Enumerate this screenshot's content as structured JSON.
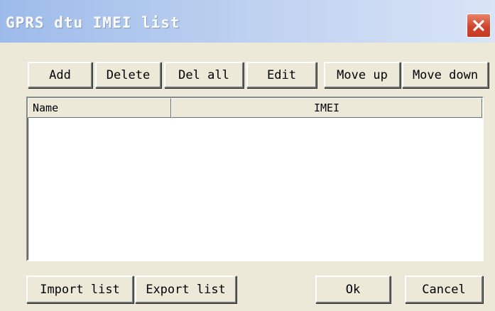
{
  "window": {
    "title": "GPRS dtu IMEI list"
  },
  "toolbar": {
    "add_label": "Add",
    "delete_label": "Delete",
    "del_all_label": "Del all",
    "edit_label": "Edit",
    "move_up_label": "Move up",
    "move_down_label": "Move down"
  },
  "list": {
    "columns": [
      "Name",
      "IMEI"
    ],
    "rows": []
  },
  "footer": {
    "import_label": "Import list",
    "export_label": "Export list",
    "ok_label": "Ok",
    "cancel_label": "Cancel"
  },
  "icons": {
    "close": "close-icon"
  }
}
